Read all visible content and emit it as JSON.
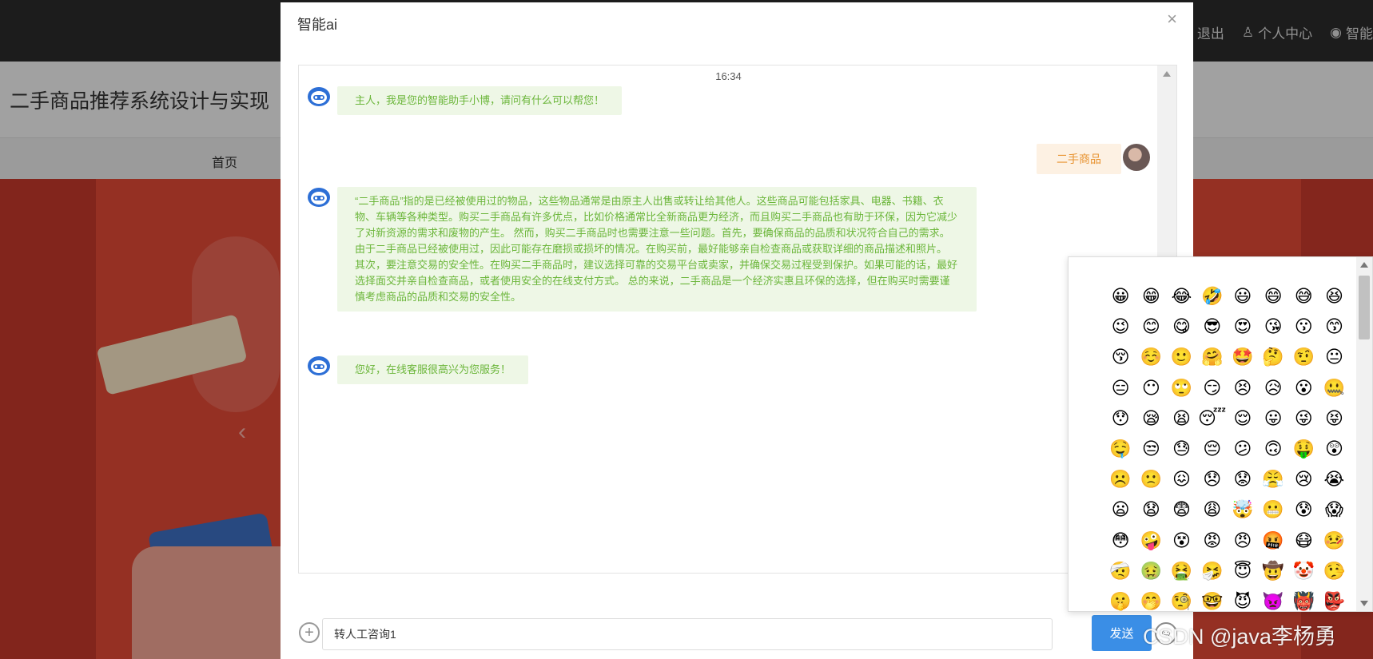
{
  "background": {
    "top_links": [
      {
        "icon": "logout-icon",
        "label": "退出"
      },
      {
        "icon": "user-icon",
        "label": "个人中心"
      },
      {
        "icon": "robot-icon",
        "label": "智能"
      }
    ],
    "site_title": "二手商品推荐系统设计与实现",
    "nav": {
      "home": "首页"
    }
  },
  "dialog": {
    "title": "智能ai",
    "close_glyph": "×",
    "time": "16:34",
    "messages": [
      {
        "from": "bot",
        "text": "主人，我是您的智能助手小博，请问有什么可以帮您！"
      },
      {
        "from": "user",
        "text": "二手商品"
      },
      {
        "from": "bot",
        "text": "“二手商品”指的是已经被使用过的物品，这些物品通常是由原主人出售或转让给其他人。这些商品可能包括家具、电器、书籍、衣物、车辆等各种类型。购买二手商品有许多优点，比如价格通常比全新商品更为经济，而且购买二手商品也有助于环保，因为它减少了对新资源的需求和废物的产生。 然而，购买二手商品时也需要注意一些问题。首先，要确保商品的品质和状况符合自己的需求。由于二手商品已经被使用过，因此可能存在磨损或损坏的情况。在购买前，最好能够亲自检查商品或获取详细的商品描述和照片。 其次，要注意交易的安全性。在购买二手商品时，建议选择可靠的交易平台或卖家，并确保交易过程受到保护。如果可能的话，最好选择面交并亲自检查商品，或者使用安全的在线支付方式。 总的来说，二手商品是一个经济实惠且环保的选择，但在购买时需要谨慎考虑商品的品质和交易的安全性。"
      },
      {
        "from": "bot",
        "text": "您好，在线客服很高兴为您服务！"
      }
    ],
    "input": {
      "value": "转人工咨询1",
      "send_label": "发送"
    }
  },
  "emoji_panel": {
    "emojis": [
      "😀",
      "😁",
      "😂",
      "🤣",
      "😃",
      "😄",
      "😅",
      "😆",
      "😉",
      "😊",
      "😋",
      "😎",
      "😍",
      "😘",
      "😗",
      "😙",
      "😚",
      "☺️",
      "🙂",
      "🤗",
      "🤩",
      "🤔",
      "🤨",
      "😐",
      "😑",
      "😶",
      "🙄",
      "😏",
      "😣",
      "😥",
      "😮",
      "🤐",
      "😯",
      "😪",
      "😫",
      "😴",
      "😌",
      "😛",
      "😜",
      "😝",
      "🤤",
      "😒",
      "😓",
      "😔",
      "😕",
      "🙃",
      "🤑",
      "😲",
      "☹️",
      "🙁",
      "😖",
      "😞",
      "😟",
      "😤",
      "😢",
      "😭",
      "😦",
      "😧",
      "😨",
      "😩",
      "🤯",
      "😬",
      "😰",
      "😱",
      "😳",
      "🤪",
      "😵",
      "😡",
      "😠",
      "🤬",
      "😷",
      "🤒",
      "🤕",
      "🤢",
      "🤮",
      "🤧",
      "😇",
      "🤠",
      "🤡",
      "🤥",
      "🤫",
      "🤭",
      "🧐",
      "🤓",
      "😈",
      "👿",
      "👹",
      "👺"
    ]
  },
  "watermark": "CSDN @java李杨勇"
}
